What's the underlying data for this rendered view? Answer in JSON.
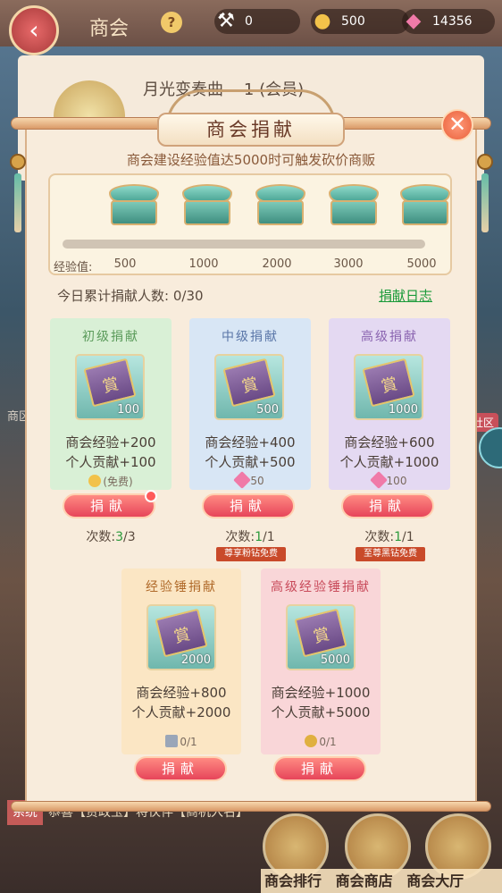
{
  "topbar": {
    "title": "商会",
    "help": "?",
    "resources": [
      {
        "icon": "hammer-icon",
        "value": "0"
      },
      {
        "icon": "coin-icon",
        "value": "500"
      },
      {
        "icon": "gem-icon",
        "value": "14356"
      }
    ]
  },
  "background": {
    "guild_name": "月光变奏曲",
    "guild_level": "1 (会员)",
    "side_text": "商区",
    "side_badge": "社区"
  },
  "modal": {
    "title": "商会捐献",
    "close": "✕",
    "subtitle": "商会建设经验值达5000时可触发砍价商贩",
    "exp_label": "经验值:",
    "milestones": [
      "500",
      "1000",
      "2000",
      "3000",
      "5000"
    ],
    "today_label": "今日累计捐献人数:",
    "today_value": "0/30",
    "log_link": "捐献日志"
  },
  "cards": [
    {
      "title": "初级捐献",
      "count": "100",
      "exp": "商会经验+200",
      "contrib": "个人贡献+100",
      "cost": "(免费)",
      "button": "捐献",
      "tries_label": "次数:",
      "tries_used": "3",
      "tries_total": "/3",
      "tag": ""
    },
    {
      "title": "中级捐献",
      "count": "500",
      "exp": "商会经验+400",
      "contrib": "个人贡献+500",
      "cost": "50",
      "button": "捐献",
      "tries_label": "次数:",
      "tries_used": "1",
      "tries_total": "/1",
      "tag": "尊享粉钻免费"
    },
    {
      "title": "高级捐献",
      "count": "1000",
      "exp": "商会经验+600",
      "contrib": "个人贡献+1000",
      "cost": "100",
      "button": "捐献",
      "tries_label": "次数:",
      "tries_used": "1",
      "tries_total": "/1",
      "tag": "至尊黑钻免费"
    },
    {
      "title": "经验锤捐献",
      "count": "2000",
      "exp": "商会经验+800",
      "contrib": "个人贡献+2000",
      "cost": "0/1",
      "button": "捐献"
    },
    {
      "title": "高级经验锤捐献",
      "count": "5000",
      "exp": "商会经验+1000",
      "contrib": "个人贡献+5000",
      "cost": "0/1",
      "button": "捐献"
    }
  ],
  "bottom": {
    "news_tag": "系统",
    "news": "恭喜【贾政玉】将伙伴【商机入名】",
    "nav": [
      "商会排行",
      "商会商店",
      "商会大厅"
    ]
  },
  "colors": {
    "card_green": "#d9f0d6",
    "card_blue": "#d8e6f5",
    "card_purple": "#e4d9f2",
    "card_orange": "#fbe6c4",
    "card_pink": "#f9d6d8",
    "button_red": "#e7455a",
    "link_green": "#1a9a3a"
  }
}
